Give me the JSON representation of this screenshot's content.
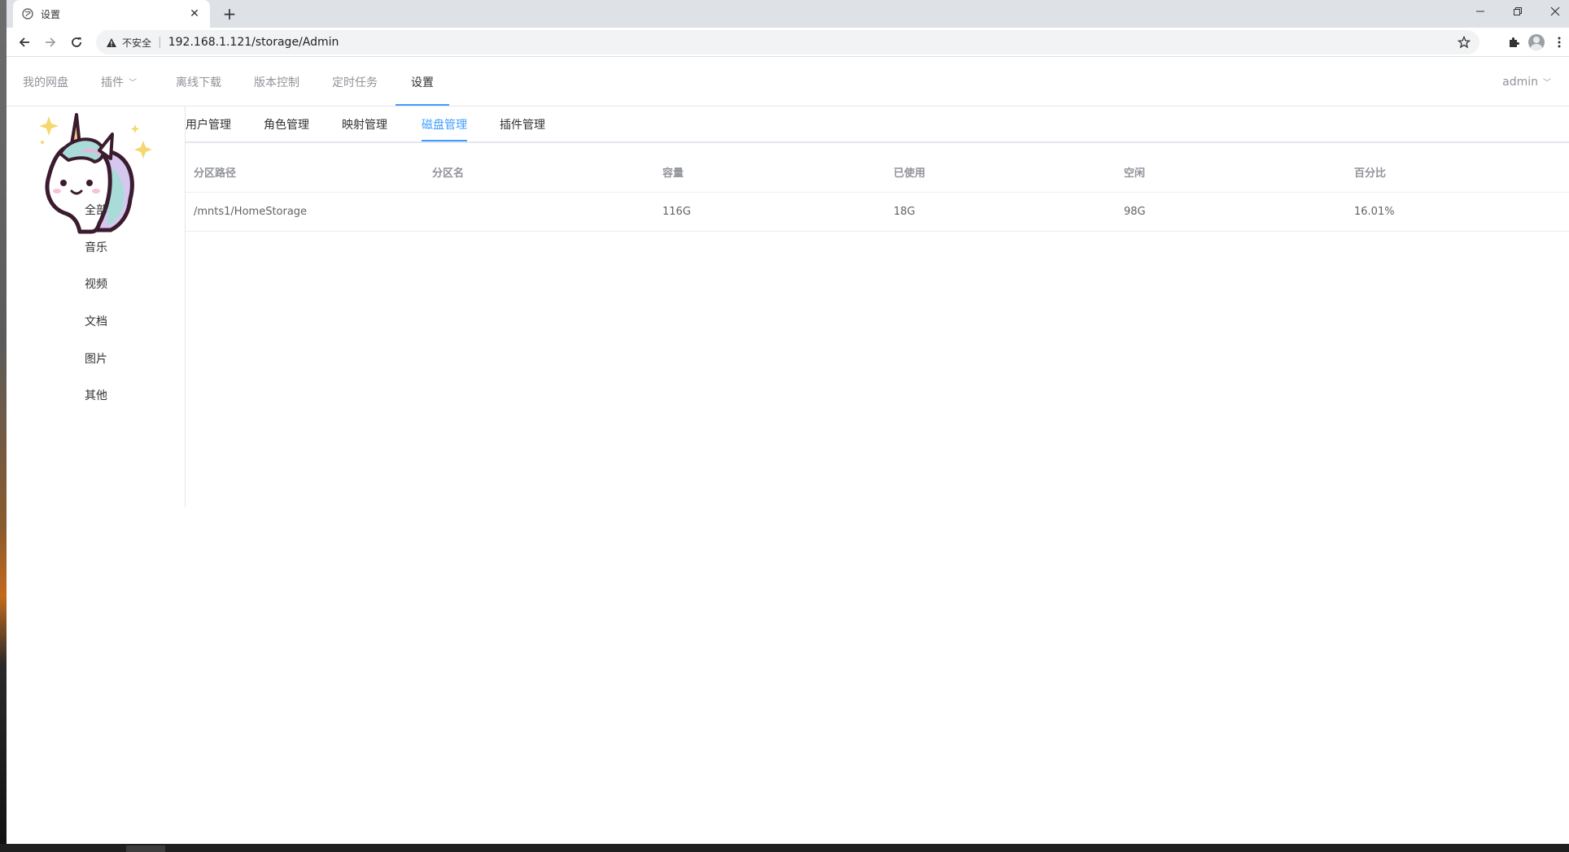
{
  "browser": {
    "tab_title": "设置",
    "security_label": "不安全",
    "url": "192.168.1.121/storage/Admin"
  },
  "nav": {
    "items": [
      {
        "label": "我的网盘"
      },
      {
        "label": "插件"
      },
      {
        "label": "离线下载"
      },
      {
        "label": "版本控制"
      },
      {
        "label": "定时任务"
      },
      {
        "label": "设置"
      }
    ],
    "user": "admin",
    "accent_color": "#409eff"
  },
  "sidebar": {
    "items": [
      {
        "label": "全部"
      },
      {
        "label": "音乐"
      },
      {
        "label": "视频"
      },
      {
        "label": "文档"
      },
      {
        "label": "图片"
      },
      {
        "label": "其他"
      }
    ]
  },
  "subtabs": {
    "items": [
      {
        "label": "用户管理"
      },
      {
        "label": "角色管理"
      },
      {
        "label": "映射管理"
      },
      {
        "label": "磁盘管理"
      },
      {
        "label": "插件管理"
      }
    ],
    "active": "磁盘管理"
  },
  "disk_table": {
    "columns": [
      "分区路径",
      "分区名",
      "容量",
      "已使用",
      "空闲",
      "百分比"
    ],
    "rows": [
      [
        "/mnts1/HomeStorage",
        "",
        "116G",
        "18G",
        "98G",
        "16.01%"
      ]
    ]
  }
}
